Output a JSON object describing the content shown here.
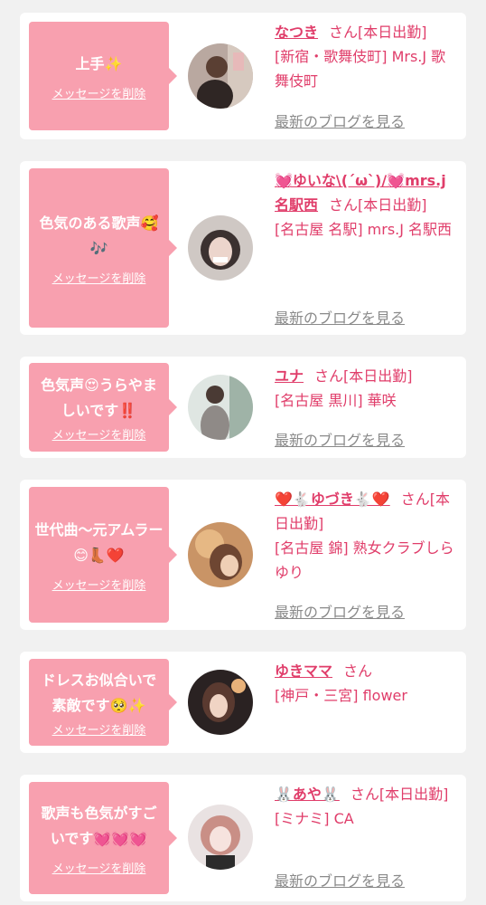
{
  "common": {
    "delete_label": "メッセージを削除",
    "blog_label": "最新のブログを見る",
    "accent_color": "#e03d6a",
    "bubble_color": "#f8a0af"
  },
  "cards": [
    {
      "message": "上手✨",
      "name": "なつき",
      "suffix": "さん[本日出勤]",
      "shop": "[新宿・歌舞伎町] Mrs.J 歌舞伎町",
      "has_blog": true
    },
    {
      "message": "色気のある歌声🥰🎶",
      "name": "💓ゆいな\\(´ω`)/💓mrs.j名駅西",
      "suffix": "さん[本日出勤]",
      "shop": "[名古屋 名駅] mrs.J 名駅西",
      "has_blog": true
    },
    {
      "message": "色気声😍うらやましいです‼️",
      "name": "ユナ",
      "suffix": "さん[本日出勤]",
      "shop": "[名古屋 黒川] 華咲",
      "has_blog": true
    },
    {
      "message": "世代曲〜元アムラー😊👢❤️",
      "name": "❤️🐇ゆづき🐇❤️",
      "suffix": "さん[本日出勤]",
      "shop": "[名古屋 錦] 熟女クラブしらゆり",
      "has_blog": true
    },
    {
      "message": "ドレスお似合いで素敵です🥺✨",
      "name": "ゆきママ",
      "suffix": "さん",
      "shop": "[神戸・三宮] flower",
      "has_blog": false
    },
    {
      "message": "歌声も色気がすごいです💓💓💓",
      "name": "🐰あや🐰",
      "suffix": "さん[本日出勤]",
      "shop": "[ミナミ] CA",
      "has_blog": true
    }
  ]
}
